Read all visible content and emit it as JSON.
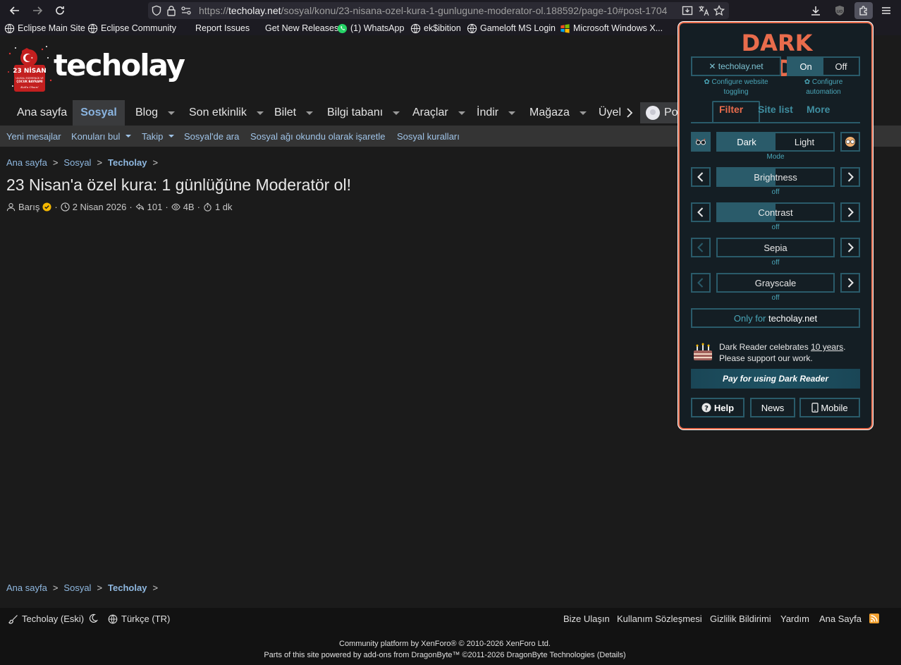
{
  "browser": {
    "url_domain": "techolay.net",
    "url_prefix": "https://",
    "url_path": "/sosyal/konu/23-nisana-ozel-kura-1-gunlugune-moderator-ol.188592/page-10#post-1704"
  },
  "bookmarks": [
    {
      "label": "Eclipse Main Site",
      "icon": "globe-icon"
    },
    {
      "label": "Eclipse Community",
      "icon": "globe-icon"
    },
    {
      "label": "Report Issues",
      "icon": ""
    },
    {
      "label": "Get New Releases",
      "icon": ""
    },
    {
      "label": "(1) WhatsApp",
      "icon": "whatsapp-icon"
    },
    {
      "label": "ek$ibition",
      "icon": "globe-icon"
    },
    {
      "label": "Gameloft MS Login",
      "icon": "globe-icon"
    },
    {
      "label": "Microsoft Windows X...",
      "icon": "windows-icon"
    }
  ],
  "site": {
    "logo_text": "techolay",
    "badge_line1": "23 NİSAN",
    "badge_line2": "ULUSAL EGEMENLİK VE",
    "badge_line3": "ÇOCUK BAYRAMI",
    "badge_line4": "Kutlu Olsun!"
  },
  "nav": {
    "home": "Ana sayfa",
    "active": "Sosyal",
    "blog": "Blog",
    "events": "Son etkinlik",
    "ticket": "Bilet",
    "kb": "Bilgi tabanı",
    "tools": "Araçlar",
    "download": "İndir",
    "store": "Mağaza",
    "members": "Üyel",
    "user_partial": "Pov"
  },
  "subnav": {
    "new_messages": "Yeni mesajlar",
    "find_threads": "Konuları bul",
    "follow": "Takip",
    "search": "Sosyal'de ara",
    "mark_read": "Sosyal ağı okundu olarak işaretle",
    "rules": "Sosyal kuralları"
  },
  "breadcrumb": {
    "home": "Ana sayfa",
    "section": "Sosyal",
    "current": "Techolay",
    "sep": ">"
  },
  "thread": {
    "title": "23 Nisan'a özel kura: 1 günlüğüne Moderatör ol!",
    "author": "Barış",
    "date": "2 Nisan 2026",
    "replies": "101",
    "views": "4B",
    "read_time": "1 dk",
    "dot": "·"
  },
  "footer": {
    "style": "Techolay (Eski)",
    "language": "Türkçe (TR)",
    "contact": "Bize Ulaşın",
    "terms": "Kullanım Sözleşmesi",
    "privacy": "Gizlilik Bildirimi",
    "help": "Yardım",
    "homepage": "Ana Sayfa",
    "copyright1": "Community platform by XenForo® © 2010-2026 XenForo Ltd.",
    "copyright2": "Parts of this site powered by add-ons from DragonByte™ ©2011-2026 DragonByte Technologies (Details)"
  },
  "dark_reader": {
    "title": "DARK READER",
    "site_toggle": "✕ techolay.net",
    "on": "On",
    "off": "Off",
    "configure_site_1": "✿ Configure website",
    "configure_site_2": "toggling",
    "configure_auto_1": "✿ Configure",
    "configure_auto_2": "automation",
    "tab_filter": "Filter",
    "tab_sitelist": "Site list",
    "tab_more": "More",
    "mode_dark": "Dark",
    "mode_light": "Light",
    "mode_label": "Mode",
    "brightness": "Brightness",
    "contrast": "Contrast",
    "sepia": "Sepia",
    "grayscale": "Grayscale",
    "off_label": "off",
    "brightness_level": 0.5,
    "contrast_level": 0.5,
    "sepia_level": 0,
    "grayscale_level": 0,
    "only_for_prefix": "Only for",
    "only_for_site": "techolay.net",
    "celebrate_1": "Dark Reader celebrates",
    "celebrate_link": "10 years",
    "celebrate_end": ".",
    "celebrate_2": "Please support our work.",
    "pay": "Pay for using Dark Reader",
    "help": "Help",
    "news": "News",
    "mobile": "Mobile"
  },
  "colors": {
    "accent": "#e96c4c",
    "teal": "#2a5b6a",
    "link": "#8fb8e0",
    "rss": "#f0a030"
  }
}
